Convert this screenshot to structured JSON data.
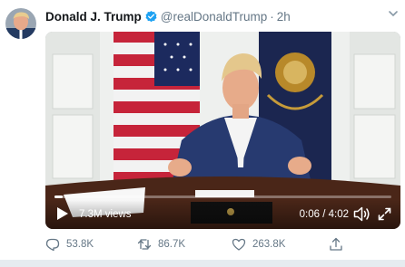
{
  "tweet": {
    "author": {
      "display_name": "Donald J. Trump",
      "handle": "@realDonaldTrump",
      "verified": true
    },
    "separator": "·",
    "time": "2h",
    "video": {
      "views": "7.3M views",
      "timecode": "0:06 / 4:02",
      "progress_fraction": 0.025
    },
    "actions": {
      "reply_count": "53.8K",
      "retweet_count": "86.7K",
      "like_count": "263.8K"
    },
    "icons": [
      "verified-icon",
      "chevron-down-icon",
      "play-icon",
      "volume-icon",
      "fullscreen-icon",
      "reply-icon",
      "retweet-icon",
      "like-icon",
      "share-icon"
    ],
    "colors": {
      "verified": "#1da1f2",
      "secondary_text": "#657786",
      "divider": "#e6ecf0"
    }
  }
}
